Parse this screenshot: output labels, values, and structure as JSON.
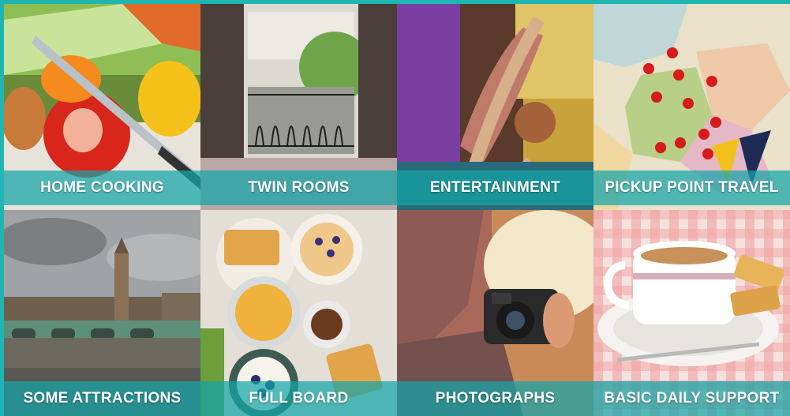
{
  "colors": {
    "accent": "#1fb6b2",
    "caption_bg": "#14a5a8",
    "caption_text": "#ffffff"
  },
  "tiles": [
    {
      "label": "HOME COOKING",
      "icon": "vegetables-photo"
    },
    {
      "label": "TWIN ROOMS",
      "icon": "window-balcony-photo"
    },
    {
      "label": "ENTERTAINMENT",
      "icon": "saxophone-photo"
    },
    {
      "label": "PICKUP POINT TRAVEL",
      "icon": "map-pins-photo"
    },
    {
      "label": "SOME ATTRACTIONS",
      "icon": "london-westminster-photo"
    },
    {
      "label": "FULL BOARD",
      "icon": "breakfast-table-photo"
    },
    {
      "label": "PHOTOGRAPHS",
      "icon": "camera-photo"
    },
    {
      "label": "BASIC DAILY SUPPORT",
      "icon": "tea-biscuits-photo"
    }
  ]
}
